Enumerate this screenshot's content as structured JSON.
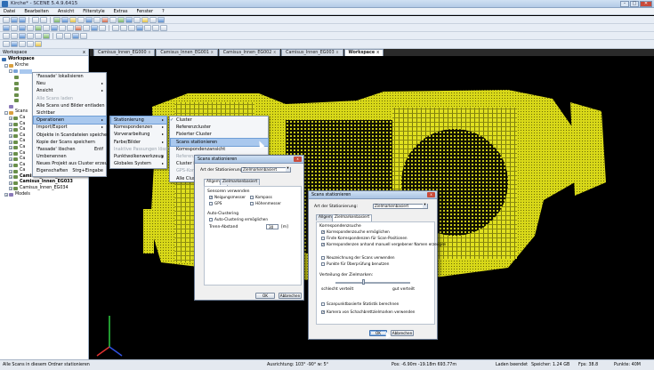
{
  "window": {
    "title": "Kirche* - SCENE 5.4.9.6415"
  },
  "menubar": [
    "Datei",
    "Bearbeiten",
    "Ansicht",
    "Filterstyle",
    "Extras",
    "Fenster",
    "?"
  ],
  "workspace_panel": {
    "title": "Workspace",
    "close": "x"
  },
  "tree": {
    "workspace": "Workspace",
    "kirche": "Kirche",
    "scan_items": [
      "",
      "",
      "",
      "",
      "",
      ""
    ],
    "scans": "Scans",
    "scan_list": [
      "Ca",
      "Ca",
      "Ca",
      "Ca",
      "Ca",
      "Ca",
      "Ca",
      "Ca",
      "Ca",
      "Ca"
    ],
    "named_scans": [
      "Camisus_Innen_EG032",
      "Camisus_Innen_EG033",
      "Camisus_Innen_EG034"
    ],
    "models": "Models"
  },
  "tabs": [
    {
      "label": "Camisus_Innen_EG000"
    },
    {
      "label": "Camisus_Innen_EG001"
    },
    {
      "label": "Camisus_Innen_EG002"
    },
    {
      "label": "Camisus_Innen_EG003"
    },
    {
      "label": "Workspace"
    }
  ],
  "menu_main": [
    {
      "label": "'Fassade' lokalisieren"
    },
    {
      "label": "Neu",
      "arrow": "▸"
    },
    {
      "label": "Ansicht",
      "arrow": "▸"
    },
    {
      "label": "Alle Scans laden"
    },
    {
      "label": "Alle Scans und Bilder entladen"
    },
    {
      "label": "Sichtbar"
    },
    {
      "label": "Operationen",
      "arrow": "▸"
    },
    {
      "label": "Import/Export",
      "arrow": "▸"
    },
    {
      "label": "Objekte in Scandateien speichern"
    },
    {
      "label": "Kopie der Scans speichern"
    },
    {
      "label": "'Fassade' löschen",
      "shortcut": "Entf"
    },
    {
      "label": "Umbenennen"
    },
    {
      "label": "Neues Projekt aus Cluster erzeugen"
    },
    {
      "label": "Eigenschaften",
      "shortcut": "Strg+Eingabe"
    }
  ],
  "menu_operationen": [
    {
      "label": "Stationierung",
      "arrow": "▸"
    },
    {
      "label": "Korrespondenzen",
      "arrow": "▸"
    },
    {
      "label": "Vorverarbeitung",
      "arrow": "▸"
    },
    {
      "label": "Farbe/Bilder",
      "arrow": "▸"
    },
    {
      "label": "Inaktive Passungen löschen"
    },
    {
      "label": "Punktwolkenwerkzeug",
      "arrow": "▸"
    },
    {
      "label": "Globales System",
      "arrow": "▸"
    }
  ],
  "menu_stationierung": [
    {
      "label": "Cluster"
    },
    {
      "label": "Referenzcluster"
    },
    {
      "label": "Fixierter Cluster"
    },
    {
      "label": "Scans stationieren"
    },
    {
      "label": "Korrespondenzansicht"
    },
    {
      "label": "Referenz"
    },
    {
      "label": "Cluster in ..."
    },
    {
      "label": "GPS-Korre..."
    },
    {
      "label": "Alle Cluster..."
    }
  ],
  "menu_check": "✓",
  "dialog1": {
    "title": "Scans stationieren",
    "close": "x",
    "art_label": "Art der Stationierung:",
    "art_value": "Zielmarkenbasiert",
    "tab_allgemein": "Allgemein",
    "tab_zielmarken": "Zielmarkenbasiert",
    "sensoren_label": "Sensoren verwenden",
    "neigungsmesser": "Neigungsmesser",
    "kompass": "Kompass",
    "gps": "GPS",
    "hoehenmesser": "Höhenmesser",
    "auto_clustering": "Auto-Clustering",
    "auto_clustering_cb": "Auto-Clustering ermöglichen",
    "trenn_label": "Trenn-Abstand",
    "trenn_value": "30",
    "trenn_unit": "[m]",
    "ok": "OK",
    "abbrechen": "Abbrechen"
  },
  "dialog2": {
    "title": "Scans stationieren",
    "close": "x",
    "art_label": "Art der Stationierung:",
    "art_value": "Zielmarkenbasiert",
    "tab_allgemein": "Allgemein",
    "tab_zielmarken": "Zielmarkenbasiert",
    "korr_label": "Korrespondenzsuche",
    "korr_cb": "Korrespondenzsuche ermöglichen",
    "finde_cb": "Finde Korrespondenzen für Scan-Positionen",
    "anhand_cb": "Korrespondenzen anhand manuell vergebener Namen erzeugen",
    "hoehe_cb": "Neuzeichnung der Scans verwenden",
    "punkte_cb": "Punkte für Überprüfung benutzen",
    "verteilung_label": "Verteilung der Zielmarken:",
    "schlecht": "schlecht verteilt",
    "gut": "gut verteilt",
    "scan_cb": "Scanpunktbasierte Statistik berechnen",
    "kamera_cb": "Kamera von Schachbrettzielmarken verwenden",
    "ok": "OK",
    "abbrechen": "Abbrechen"
  },
  "statusbar": {
    "hint": "Alle Scans in diesem Ordner stationieren",
    "ausrichtung": "Ausrichtung: 103° -90° w: 5°",
    "pos": "Pos: -6.90m -19.18m 693.77m",
    "laden": "Laden beendet",
    "speicher": "Speicher: 1.24 GB",
    "fps": "Fps: 38.8",
    "punkte": "Punkte: 40M"
  },
  "colors": {
    "points": "#dede1c",
    "accent": "#3a6fb0",
    "highlight": "#a9c8ee"
  }
}
